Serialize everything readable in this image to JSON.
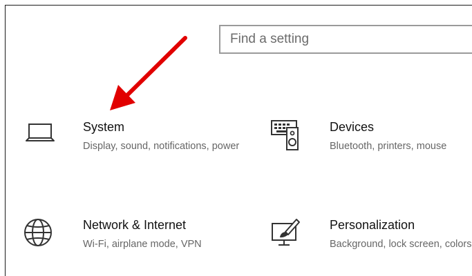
{
  "search": {
    "placeholder": "Find a setting"
  },
  "tiles": [
    {
      "title": "System",
      "description": "Display, sound, notifications, power",
      "icon": "laptop-icon"
    },
    {
      "title": "Devices",
      "description": "Bluetooth, printers, mouse",
      "icon": "devices-icon"
    },
    {
      "title": "Network & Internet",
      "description": "Wi-Fi, airplane mode, VPN",
      "icon": "globe-icon"
    },
    {
      "title": "Personalization",
      "description": "Background, lock screen, colors",
      "icon": "paint-monitor-icon"
    }
  ],
  "colors": {
    "annotation_arrow": "#e10000",
    "icon_stroke": "#333333",
    "search_border": "#9a9a9a"
  }
}
